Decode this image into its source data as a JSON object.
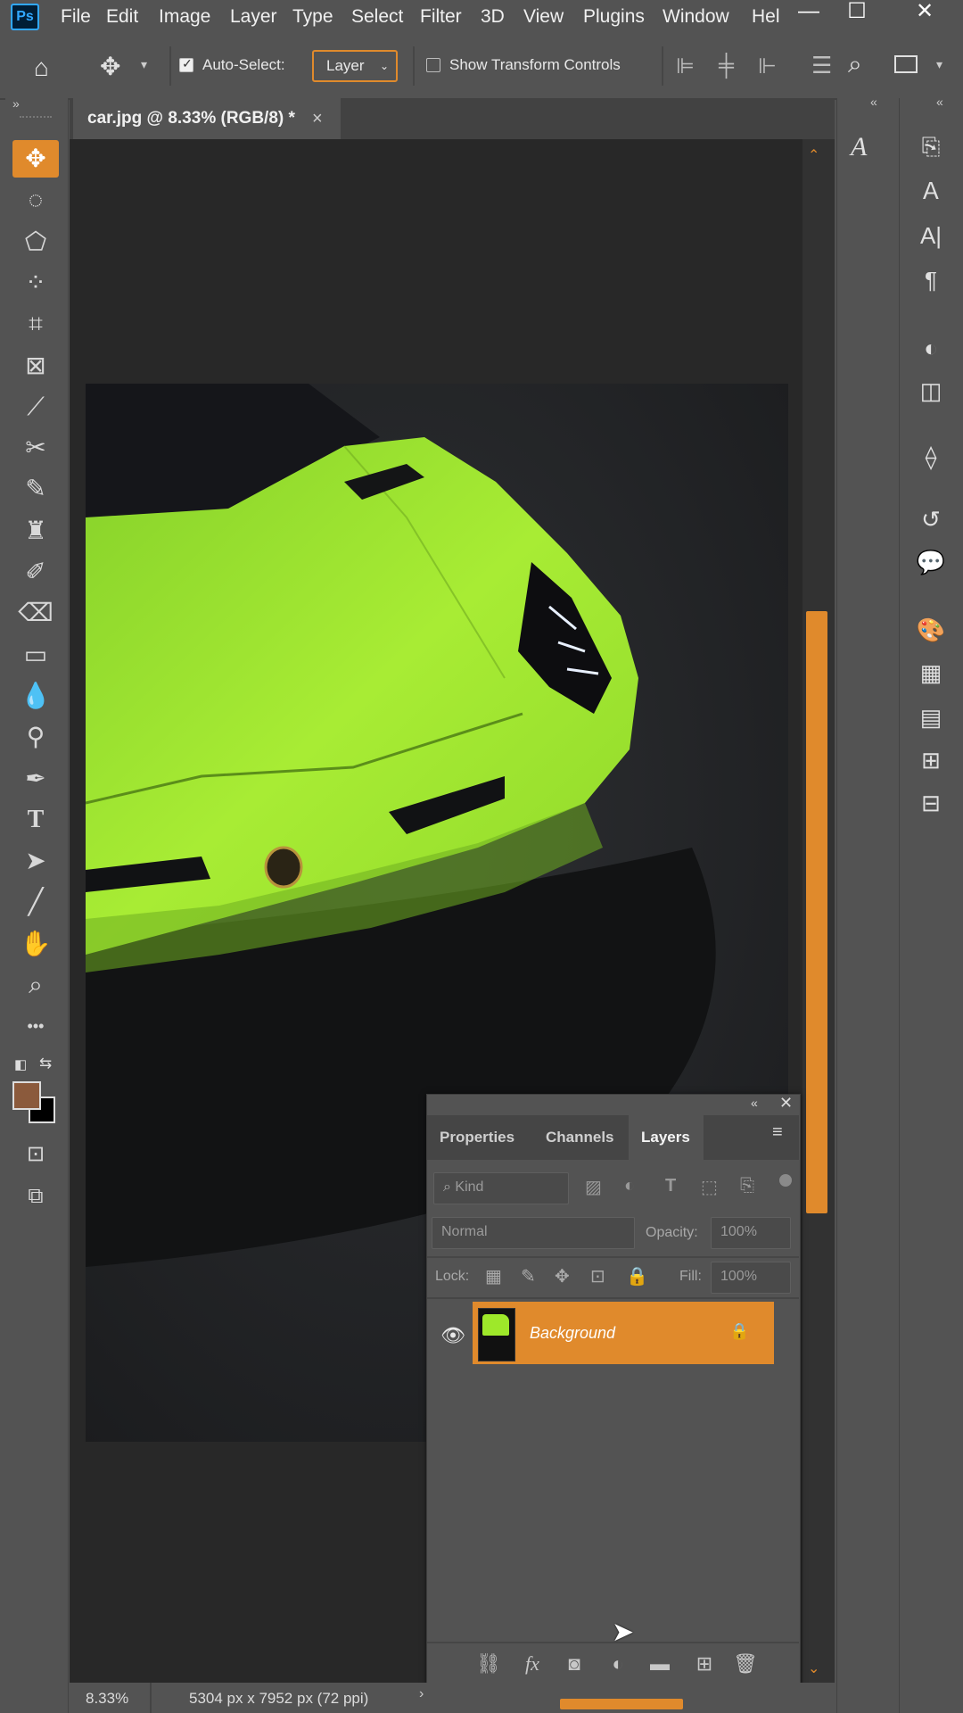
{
  "app": {
    "logo_text": "Ps"
  },
  "menu": [
    "File",
    "Edit",
    "Image",
    "Layer",
    "Type",
    "Select",
    "Filter",
    "3D",
    "View",
    "Plugins",
    "Window",
    "Hel"
  ],
  "window_controls": {
    "minimize": "—",
    "maximize": "☐",
    "close": "✕"
  },
  "options_bar": {
    "auto_select_label": "Auto-Select:",
    "auto_select_checked": true,
    "auto_select_target": "Layer",
    "show_transform_label": "Show Transform Controls",
    "show_transform_checked": false
  },
  "document": {
    "tab_title": "car.jpg @ 8.33% (RGB/8) *",
    "close_glyph": "×"
  },
  "tools": [
    {
      "icon": "move-tool-icon",
      "glyph": "✥",
      "active": true
    },
    {
      "icon": "elliptical-marquee-icon",
      "glyph": "◌"
    },
    {
      "icon": "polygonal-lasso-icon",
      "glyph": "⬠"
    },
    {
      "icon": "quick-selection-icon",
      "glyph": "⁘"
    },
    {
      "icon": "crop-tool-icon",
      "glyph": "⌗"
    },
    {
      "icon": "frame-tool-icon",
      "glyph": "⊠"
    },
    {
      "icon": "eyedropper-icon",
      "glyph": "⟋"
    },
    {
      "icon": "healing-brush-icon",
      "glyph": "✂"
    },
    {
      "icon": "brush-tool-icon",
      "glyph": "✎"
    },
    {
      "icon": "clone-stamp-icon",
      "glyph": "♜"
    },
    {
      "icon": "history-brush-icon",
      "glyph": "✐"
    },
    {
      "icon": "eraser-icon",
      "glyph": "⌫"
    },
    {
      "icon": "gradient-tool-icon",
      "glyph": "▭"
    },
    {
      "icon": "blur-tool-icon",
      "glyph": "💧"
    },
    {
      "icon": "dodge-tool-icon",
      "glyph": "⚲"
    },
    {
      "icon": "pen-tool-icon",
      "glyph": "✒"
    },
    {
      "icon": "type-tool-icon",
      "glyph": "T"
    },
    {
      "icon": "path-selection-icon",
      "glyph": "➤"
    },
    {
      "icon": "line-tool-icon",
      "glyph": "╱"
    },
    {
      "icon": "hand-tool-icon",
      "glyph": "✋"
    },
    {
      "icon": "zoom-tool-icon",
      "glyph": "⌕"
    },
    {
      "icon": "more-tools-icon",
      "glyph": "•••"
    }
  ],
  "colors": {
    "accent": "#e08a2c",
    "foreground": "#8b5a3c",
    "background": "#000000",
    "car_green": "#9ee82a"
  },
  "right_panel_icons": [
    "glyphs-icon",
    "paragraph-styles-icon",
    "character-styles-icon",
    "character-icon",
    "paragraph-icon",
    "adjustments-icon",
    "libraries-icon",
    "paths-icon",
    "history-icon",
    "comments-icon",
    "color-swatches-icon",
    "patterns-icon",
    "gradients-icon",
    "swatches-icon"
  ],
  "layers_panel": {
    "tabs": [
      "Properties",
      "Channels",
      "Layers"
    ],
    "active_tab": "Layers",
    "filter_placeholder": "Kind",
    "blend_mode": "Normal",
    "opacity_label": "Opacity:",
    "opacity_value": "100%",
    "lock_label": "Lock:",
    "fill_label": "Fill:",
    "fill_value": "100%",
    "layers": [
      {
        "name": "Background",
        "visible": true,
        "locked": true,
        "selected": true
      }
    ]
  },
  "status": {
    "zoom": "8.33%",
    "dimensions": "5304 px x 7952 px (72 ppi)"
  }
}
